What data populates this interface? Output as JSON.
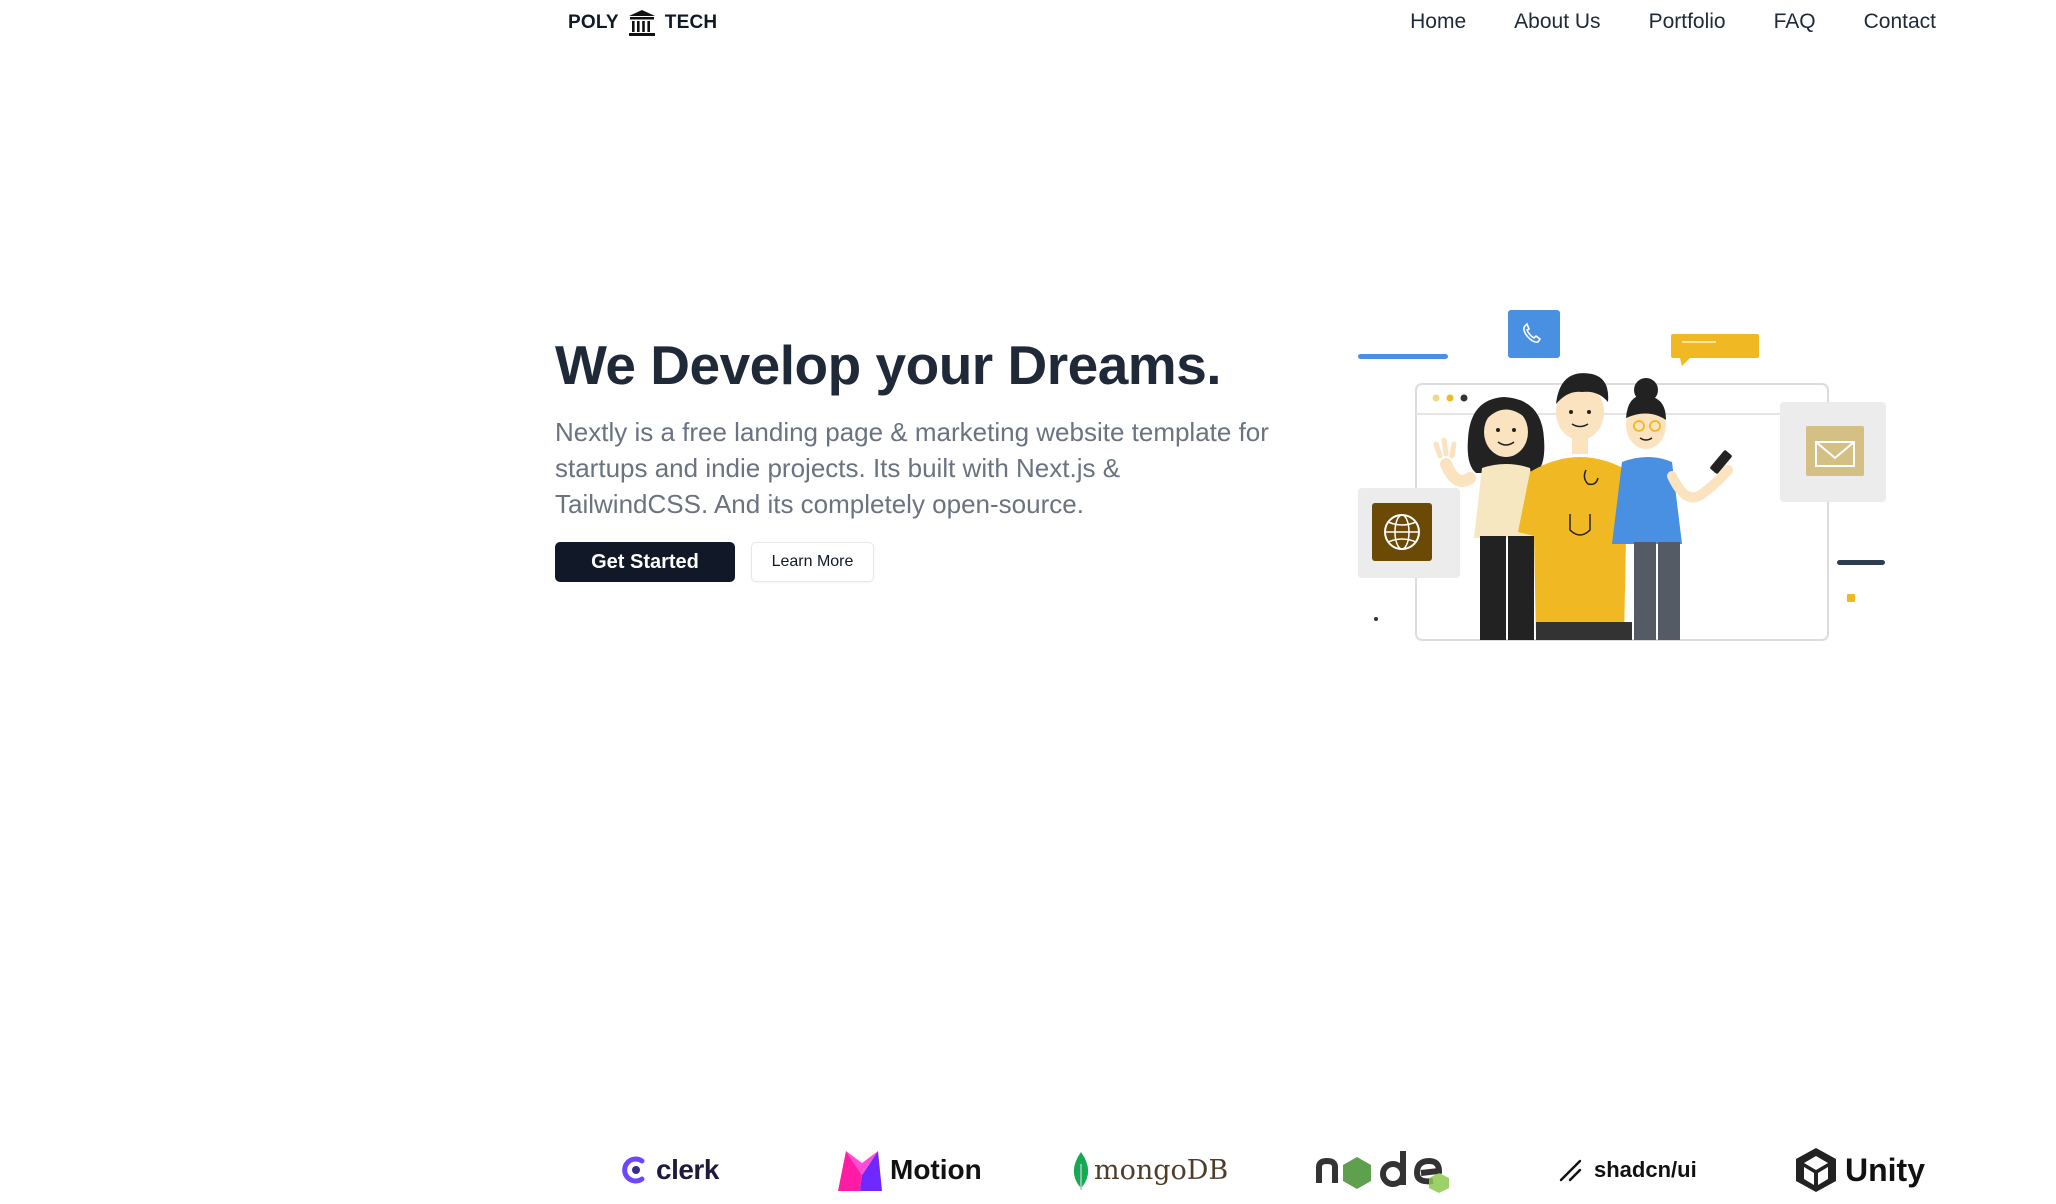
{
  "nav": {
    "logo_left": "POLY",
    "logo_right": "TECH",
    "logo_icon": "institution-icon",
    "links": [
      "Home",
      "About Us",
      "Portfolio",
      "FAQ",
      "Contact"
    ]
  },
  "hero": {
    "title": "We Develop your Dreams.",
    "description": "Nextly is a free landing page & marketing website template for startups and indie projects. Its built with Next.js & TailwindCSS. And its completely open-source.",
    "primary_button": "Get Started",
    "secondary_button": "Learn More"
  },
  "brands": {
    "clerk": "clerk",
    "motion": "Motion",
    "mongodb": "mongoDB",
    "shadcn": "shadcn/ui",
    "unity": "Unity"
  },
  "colors": {
    "primary_button": "#111827",
    "accent_yellow": "#f0b823",
    "accent_blue": "#4a90e2",
    "globe_brown": "#6b4a06"
  }
}
